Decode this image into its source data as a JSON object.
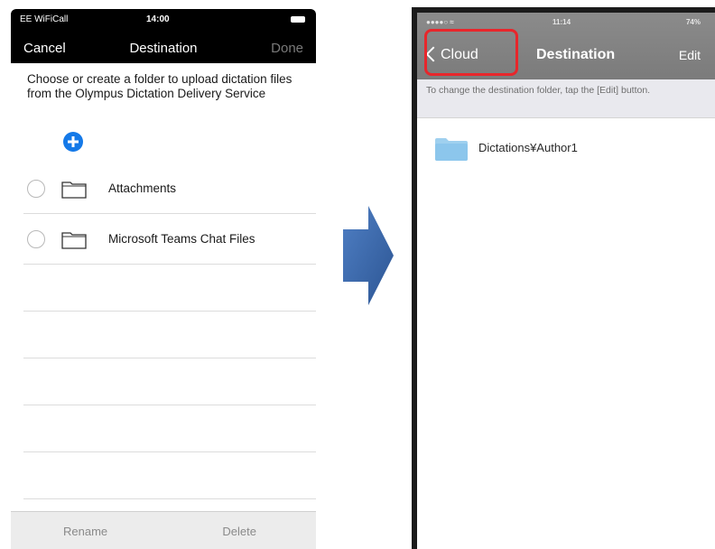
{
  "left_screen": {
    "status_bar": {
      "carrier": "EE WiFiCall",
      "time": "14:00"
    },
    "nav": {
      "cancel": "Cancel",
      "title": "Destination",
      "done": "Done"
    },
    "description": "Choose or create a folder to upload dictation files from the Olympus Dictation Delivery Service",
    "add_icon": "plus-circle-icon",
    "folders": [
      {
        "label": "Attachments"
      },
      {
        "label": "Microsoft Teams Chat Files"
      }
    ],
    "toolbar": {
      "rename": "Rename",
      "delete": "Delete"
    }
  },
  "arrow": {
    "direction": "right",
    "color": "#3a66a8"
  },
  "right_screen": {
    "status_bar": {
      "time": "11:14",
      "battery": "74%"
    },
    "nav": {
      "back": "Cloud",
      "title": "Destination",
      "edit": "Edit"
    },
    "hint": "To change the destination folder, tap the [Edit] button.",
    "folder": {
      "label": "Dictations¥Author1"
    },
    "highlight_color": "#e8262b"
  }
}
